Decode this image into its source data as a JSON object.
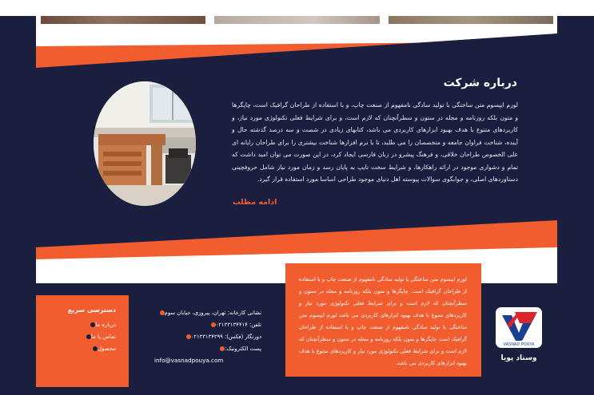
{
  "colors": {
    "navy": "#1b1f3f",
    "orange": "#f25d2f",
    "white": "#ffffff"
  },
  "about": {
    "title": "درباره شرکت",
    "text": "لورم ایپسوم متن ساختگی با تولید سادگی نامفهوم از صنعت چاپ، و با استفاده از طراحان گرافیک است، چاپگرها و متون بلکه روزنامه و مجله در ستون و سطرآنچنان که لازم است، و برای شرایط فعلی تکنولوژی مورد نیاز، و کاربردهای متنوع با هدف بهبود ابزارهای کاربردی می باشد، کتابهای زیادی در شصت و سه درصد گذشته حال و آینده، شناخت فراوان جامعه و متخصصان را می طلبد، تا با نرم افزارها شناخت بیشتری را برای طراحان رایانه ای علی الخصوص طراحان خلاقی، و فرهنگ پیشرو در زبان فارسی ایجاد کرد، در این صورت می توان امید داشت که تمام و دشواری موجود در ارائه راهکارها، و شرایط سخت تایپ به پایان رسد و زمان مورد نیاز شامل حروفچینی دستاوردهای اصلی، و جوابگوی سوالات پیوسته اهل دنیای موجود طراحی اساسا مورد استفاده قرار گیرد.",
    "more_link": "ادامه مطلب"
  },
  "footer": {
    "quick_access": {
      "title": "دسترسی سریع",
      "items": [
        "درباره ما",
        "تماس با ما",
        "محصول"
      ]
    },
    "contact": {
      "address": "نشانی کارخانه: تهران، پیروزی، خیابان سوم",
      "phone": "تلفن: ۰۲۱۳۳۱۳۴۴۱۴",
      "fax": "دورنگار (فکس): ۰۲۱۳۳۱۳۴۲۹۹",
      "email_label": "پست الکترونیک:",
      "email": "info@vasnadpouya.com"
    },
    "orange_text": "لورم ایپسوم متن ساختگی با تولید سادگی نامفهوم از صنعت چاپ و با استفاده از طراحان گرافیک است. چاپگرها و متون بلکه روزنامه و مجله در ستون و سطرآنچنان که لازم است و برای شرایط فعلی تکنولوژی مورد نیاز و کاربردهای متنوع با هدف بهبود ابزارهای کاربردی می باشد لورم ایپسوم متن ساختگی با تولید سادگی نامفهوم از صنعت چاپ و با استفاده از طراحان گرافیک است چاپگرها و متون بلکه روزنامه و مجله در ستون و سطرآنچنان که لازم است و برای شرایط فعلی تکنولوژی مورد نیاز و کاربردهای متنوع با هدف بهبود ابزارهای کاربردی می باشد.",
    "logo": {
      "mark_text": "VASNAD POUYA",
      "caption": "وسناد پویا"
    }
  }
}
